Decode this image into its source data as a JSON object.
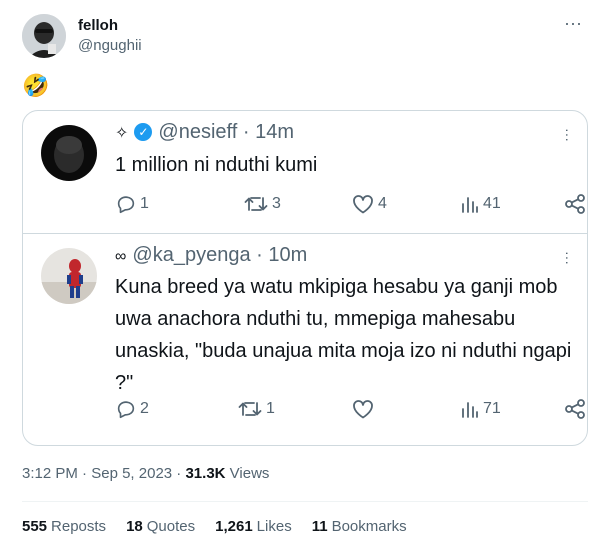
{
  "author": {
    "name": "felloh",
    "handle": "@ngughii",
    "more_icon": "more-horizontal-icon"
  },
  "tweet": {
    "text": "🤣"
  },
  "quoted_thread": [
    {
      "prefix_symbol": "✧",
      "verified": true,
      "handle": "@nesieff",
      "separator": "·",
      "time": "14m",
      "text": "1 million ni nduthi kumi",
      "replies": "1",
      "retweets": "3",
      "likes": "4",
      "views": "41"
    },
    {
      "prefix_symbol": "∞",
      "verified": false,
      "handle": "@ka_pyenga",
      "separator": "·",
      "time": "10m",
      "text": "Kuna breed ya watu mkipiga hesabu ya ganji mob uwa anachora nduthi tu, mmepiga mahesabu unaskia, \"buda unajua mita moja izo ni nduthi ngapi ?\"",
      "replies": "2",
      "retweets": "1",
      "likes": "",
      "views": "71"
    }
  ],
  "meta": {
    "time": "3:12 PM",
    "dot1": "·",
    "date": "Sep 5, 2023",
    "dot2": "·",
    "views_count": "31.3K",
    "views_label": "Views"
  },
  "stats": {
    "reposts_count": "555",
    "reposts_label": "Reposts",
    "quotes_count": "18",
    "quotes_label": "Quotes",
    "likes_count": "1,261",
    "likes_label": "Likes",
    "bookmarks_count": "11",
    "bookmarks_label": "Bookmarks"
  },
  "colors": {
    "secondary_text": "#536471",
    "primary_text": "#0f1419",
    "verified_blue": "#1d9bf0",
    "border": "#cfd9de"
  }
}
